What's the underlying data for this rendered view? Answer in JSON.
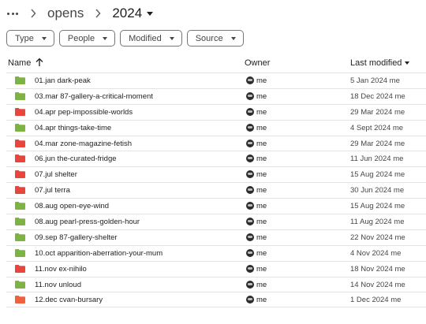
{
  "breadcrumb": {
    "parent": "opens",
    "current": "2024"
  },
  "filters": [
    {
      "label": "Type"
    },
    {
      "label": "People"
    },
    {
      "label": "Modified"
    },
    {
      "label": "Source"
    }
  ],
  "columns": {
    "name": "Name",
    "owner": "Owner",
    "last_modified": "Last modified"
  },
  "colors": {
    "folder_green": "#7cb342",
    "folder_red": "#e8453c",
    "folder_orange": "#f0613f"
  },
  "files": [
    {
      "name": "01.jan dark-peak",
      "owner": "me",
      "modified": "5 Jan 2024 me",
      "color": "green"
    },
    {
      "name": "03.mar 87-gallery-a-critical-moment",
      "owner": "me",
      "modified": "18 Dec 2024 me",
      "color": "green"
    },
    {
      "name": "04.apr pep-impossible-worlds",
      "owner": "me",
      "modified": "29 Mar 2024 me",
      "color": "red"
    },
    {
      "name": "04.apr things-take-time",
      "owner": "me",
      "modified": "4 Sept 2024 me",
      "color": "green"
    },
    {
      "name": "04.mar zone-magazine-fetish",
      "owner": "me",
      "modified": "29 Mar 2024 me",
      "color": "red"
    },
    {
      "name": "06.jun the-curated-fridge",
      "owner": "me",
      "modified": "11 Jun 2024 me",
      "color": "red"
    },
    {
      "name": "07.jul shelter",
      "owner": "me",
      "modified": "15 Aug 2024 me",
      "color": "red"
    },
    {
      "name": "07.jul terra",
      "owner": "me",
      "modified": "30 Jun 2024 me",
      "color": "red"
    },
    {
      "name": "08.aug open-eye-wind",
      "owner": "me",
      "modified": "15 Aug 2024 me",
      "color": "green"
    },
    {
      "name": "08.aug pearl-press-golden-hour",
      "owner": "me",
      "modified": "11 Aug 2024 me",
      "color": "green"
    },
    {
      "name": "09.sep 87-gallery-shelter",
      "owner": "me",
      "modified": "22 Nov 2024 me",
      "color": "green"
    },
    {
      "name": "10.oct apparition-aberration-your-mum",
      "owner": "me",
      "modified": "4 Nov 2024 me",
      "color": "green"
    },
    {
      "name": "11.nov ex-nihilo",
      "owner": "me",
      "modified": "18 Nov 2024 me",
      "color": "red"
    },
    {
      "name": "11.nov unloud",
      "owner": "me",
      "modified": "14 Nov 2024 me",
      "color": "green"
    },
    {
      "name": "12.dec cvan-bursary",
      "owner": "me",
      "modified": "1 Dec 2024 me",
      "color": "orange"
    }
  ]
}
